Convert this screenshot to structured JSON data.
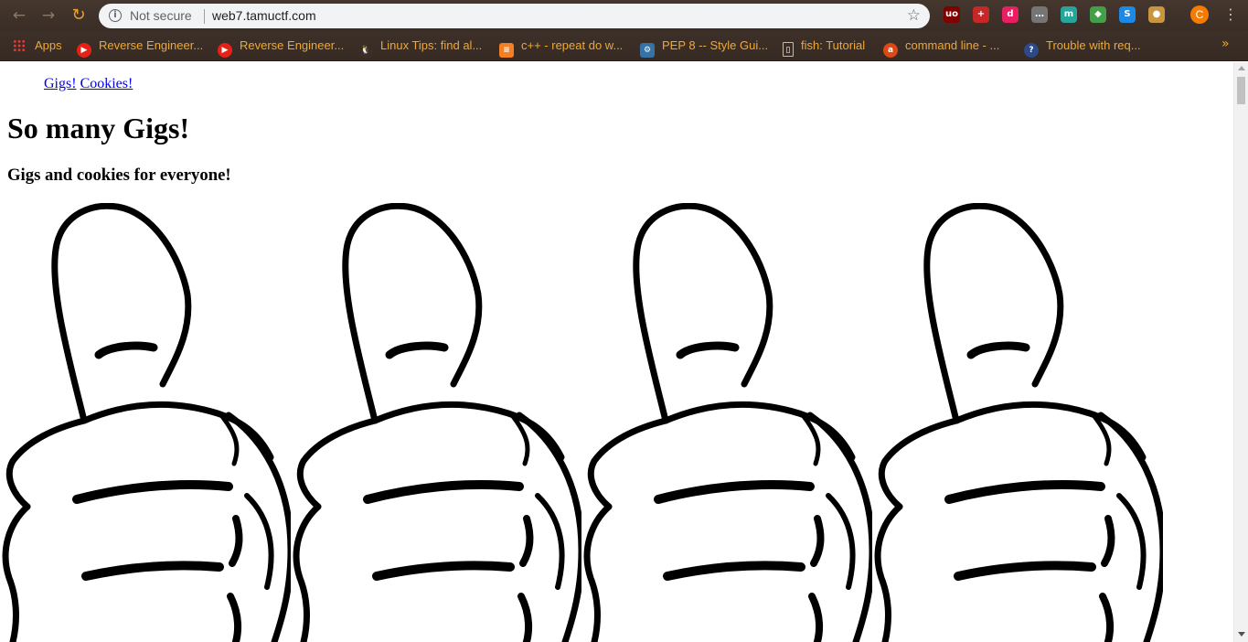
{
  "browser": {
    "security_label": "Not secure",
    "url": "web7.tamuctf.com",
    "profile_initial": "C",
    "extensions": [
      {
        "icon": "ublock-icon",
        "label": "uo",
        "color": "#800000"
      },
      {
        "icon": "plus-shield-icon",
        "label": "+",
        "color": "#c62828"
      },
      {
        "icon": "d-extension-icon",
        "label": "d",
        "color": "#e91e63"
      },
      {
        "icon": "chat-bubble-icon",
        "label": "…",
        "color": "#757575"
      },
      {
        "icon": "m-extension-icon",
        "label": "m",
        "color": "#26a69a"
      },
      {
        "icon": "layers-icon",
        "label": "◆",
        "color": "#43a047"
      },
      {
        "icon": "s-extension-icon",
        "label": "S",
        "color": "#1e88e5"
      },
      {
        "icon": "cookie-icon",
        "label": "●",
        "color": "#c8963e"
      }
    ]
  },
  "bookmarks": {
    "apps_label": "Apps",
    "items": [
      {
        "label": "Reverse Engineer...",
        "icon": "youtube-icon"
      },
      {
        "label": "Reverse Engineer...",
        "icon": "youtube-icon"
      },
      {
        "label": "Linux Tips: find al...",
        "icon": "linux-tux-icon"
      },
      {
        "label": "c++ - repeat do w...",
        "icon": "stackoverflow-icon"
      },
      {
        "label": "PEP 8 -- Style Gui...",
        "icon": "python-icon"
      },
      {
        "label": "fish: Tutorial",
        "icon": "document-icon"
      },
      {
        "label": "command line - ...",
        "icon": "askubuntu-icon"
      },
      {
        "label": "Trouble with req...",
        "icon": "question-icon"
      }
    ]
  },
  "page": {
    "links": [
      "Gigs!",
      "Cookies!"
    ],
    "title": "So many Gigs!",
    "subtitle": "Gigs and cookies for everyone!"
  },
  "colors": {
    "link": "#0000ee",
    "bookmark_text": "#f0a830",
    "toolbar_bg": "#3b2f28"
  }
}
